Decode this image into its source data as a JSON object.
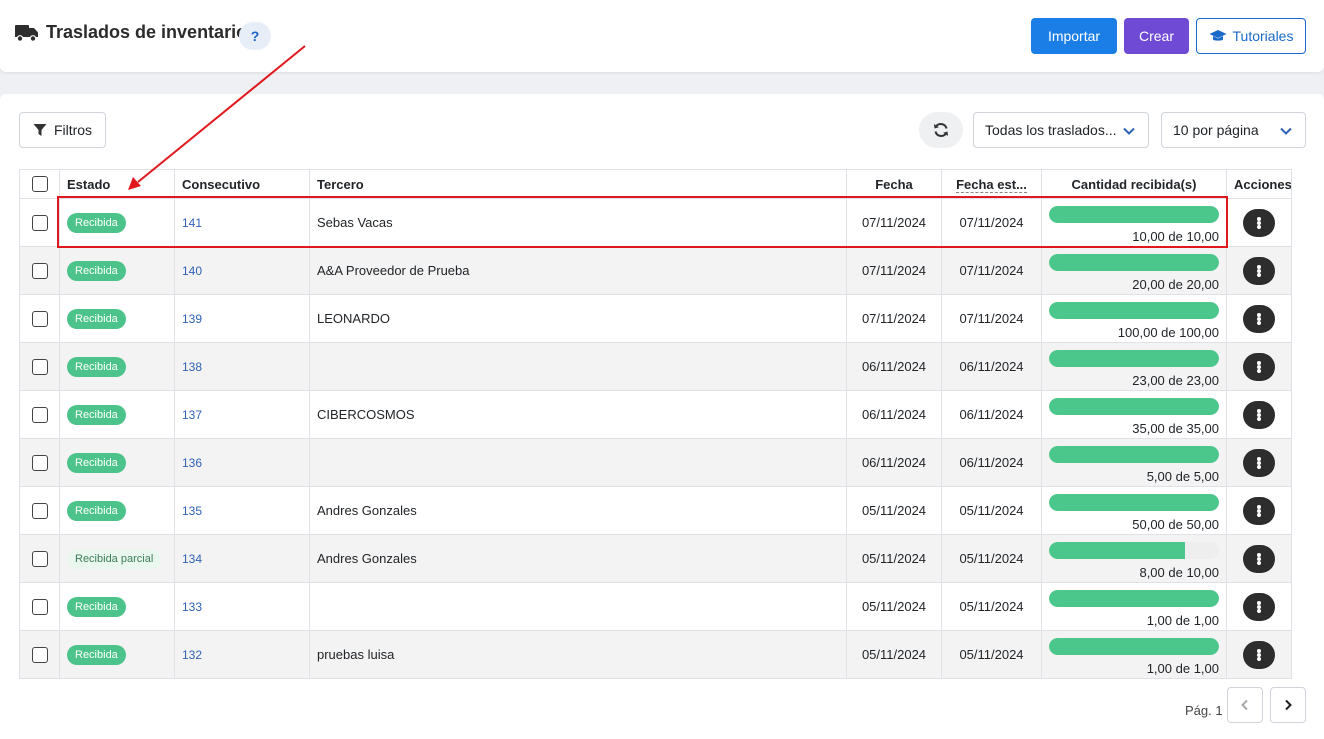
{
  "header": {
    "title": "Traslados de inventario",
    "help_label": "?",
    "import_label": "Importar",
    "create_label": "Crear",
    "tutorials_label": "Tutoriales"
  },
  "toolbar": {
    "filters_label": "Filtros",
    "traslados_select": "Todas los traslados...",
    "per_page_select": "10 por página"
  },
  "table": {
    "columns": [
      "Estado",
      "Consecutivo",
      "Tercero",
      "Fecha",
      "Fecha est...",
      "Cantidad recibida(s)",
      "Acciones"
    ],
    "rows": [
      {
        "estado": "Recibida",
        "consecutivo": "141",
        "tercero": "Sebas Vacas",
        "fecha": "07/11/2024",
        "fecha_est": "07/11/2024",
        "progress": 1.0,
        "cantidad": "10,00 de 10,00"
      },
      {
        "estado": "Recibida",
        "consecutivo": "140",
        "tercero": "A&A Proveedor de Prueba",
        "fecha": "07/11/2024",
        "fecha_est": "07/11/2024",
        "progress": 1.0,
        "cantidad": "20,00 de 20,00"
      },
      {
        "estado": "Recibida",
        "consecutivo": "139",
        "tercero": "LEONARDO",
        "fecha": "07/11/2024",
        "fecha_est": "07/11/2024",
        "progress": 1.0,
        "cantidad": "100,00 de 100,00"
      },
      {
        "estado": "Recibida",
        "consecutivo": "138",
        "tercero": "",
        "fecha": "06/11/2024",
        "fecha_est": "06/11/2024",
        "progress": 1.0,
        "cantidad": "23,00 de 23,00"
      },
      {
        "estado": "Recibida",
        "consecutivo": "137",
        "tercero": "CIBERCOSMOS",
        "fecha": "06/11/2024",
        "fecha_est": "06/11/2024",
        "progress": 1.0,
        "cantidad": "35,00 de 35,00"
      },
      {
        "estado": "Recibida",
        "consecutivo": "136",
        "tercero": "",
        "fecha": "06/11/2024",
        "fecha_est": "06/11/2024",
        "progress": 1.0,
        "cantidad": "5,00 de 5,00"
      },
      {
        "estado": "Recibida",
        "consecutivo": "135",
        "tercero": "Andres Gonzales",
        "fecha": "05/11/2024",
        "fecha_est": "05/11/2024",
        "progress": 1.0,
        "cantidad": "50,00 de 50,00"
      },
      {
        "estado": "Recibida parcial",
        "consecutivo": "134",
        "tercero": "Andres Gonzales",
        "fecha": "05/11/2024",
        "fecha_est": "05/11/2024",
        "progress": 0.8,
        "cantidad": "8,00 de 10,00"
      },
      {
        "estado": "Recibida",
        "consecutivo": "133",
        "tercero": "",
        "fecha": "05/11/2024",
        "fecha_est": "05/11/2024",
        "progress": 1.0,
        "cantidad": "1,00 de 1,00"
      },
      {
        "estado": "Recibida",
        "consecutivo": "132",
        "tercero": "pruebas luisa",
        "fecha": "05/11/2024",
        "fecha_est": "05/11/2024",
        "progress": 1.0,
        "cantidad": "1,00 de 1,00"
      }
    ]
  },
  "pagination": {
    "label": "Pág. 1"
  },
  "colors": {
    "primary": "#1a7ee6",
    "create": "#6e4ad5",
    "success": "#4cc38a",
    "annotation": "#e0181d"
  }
}
